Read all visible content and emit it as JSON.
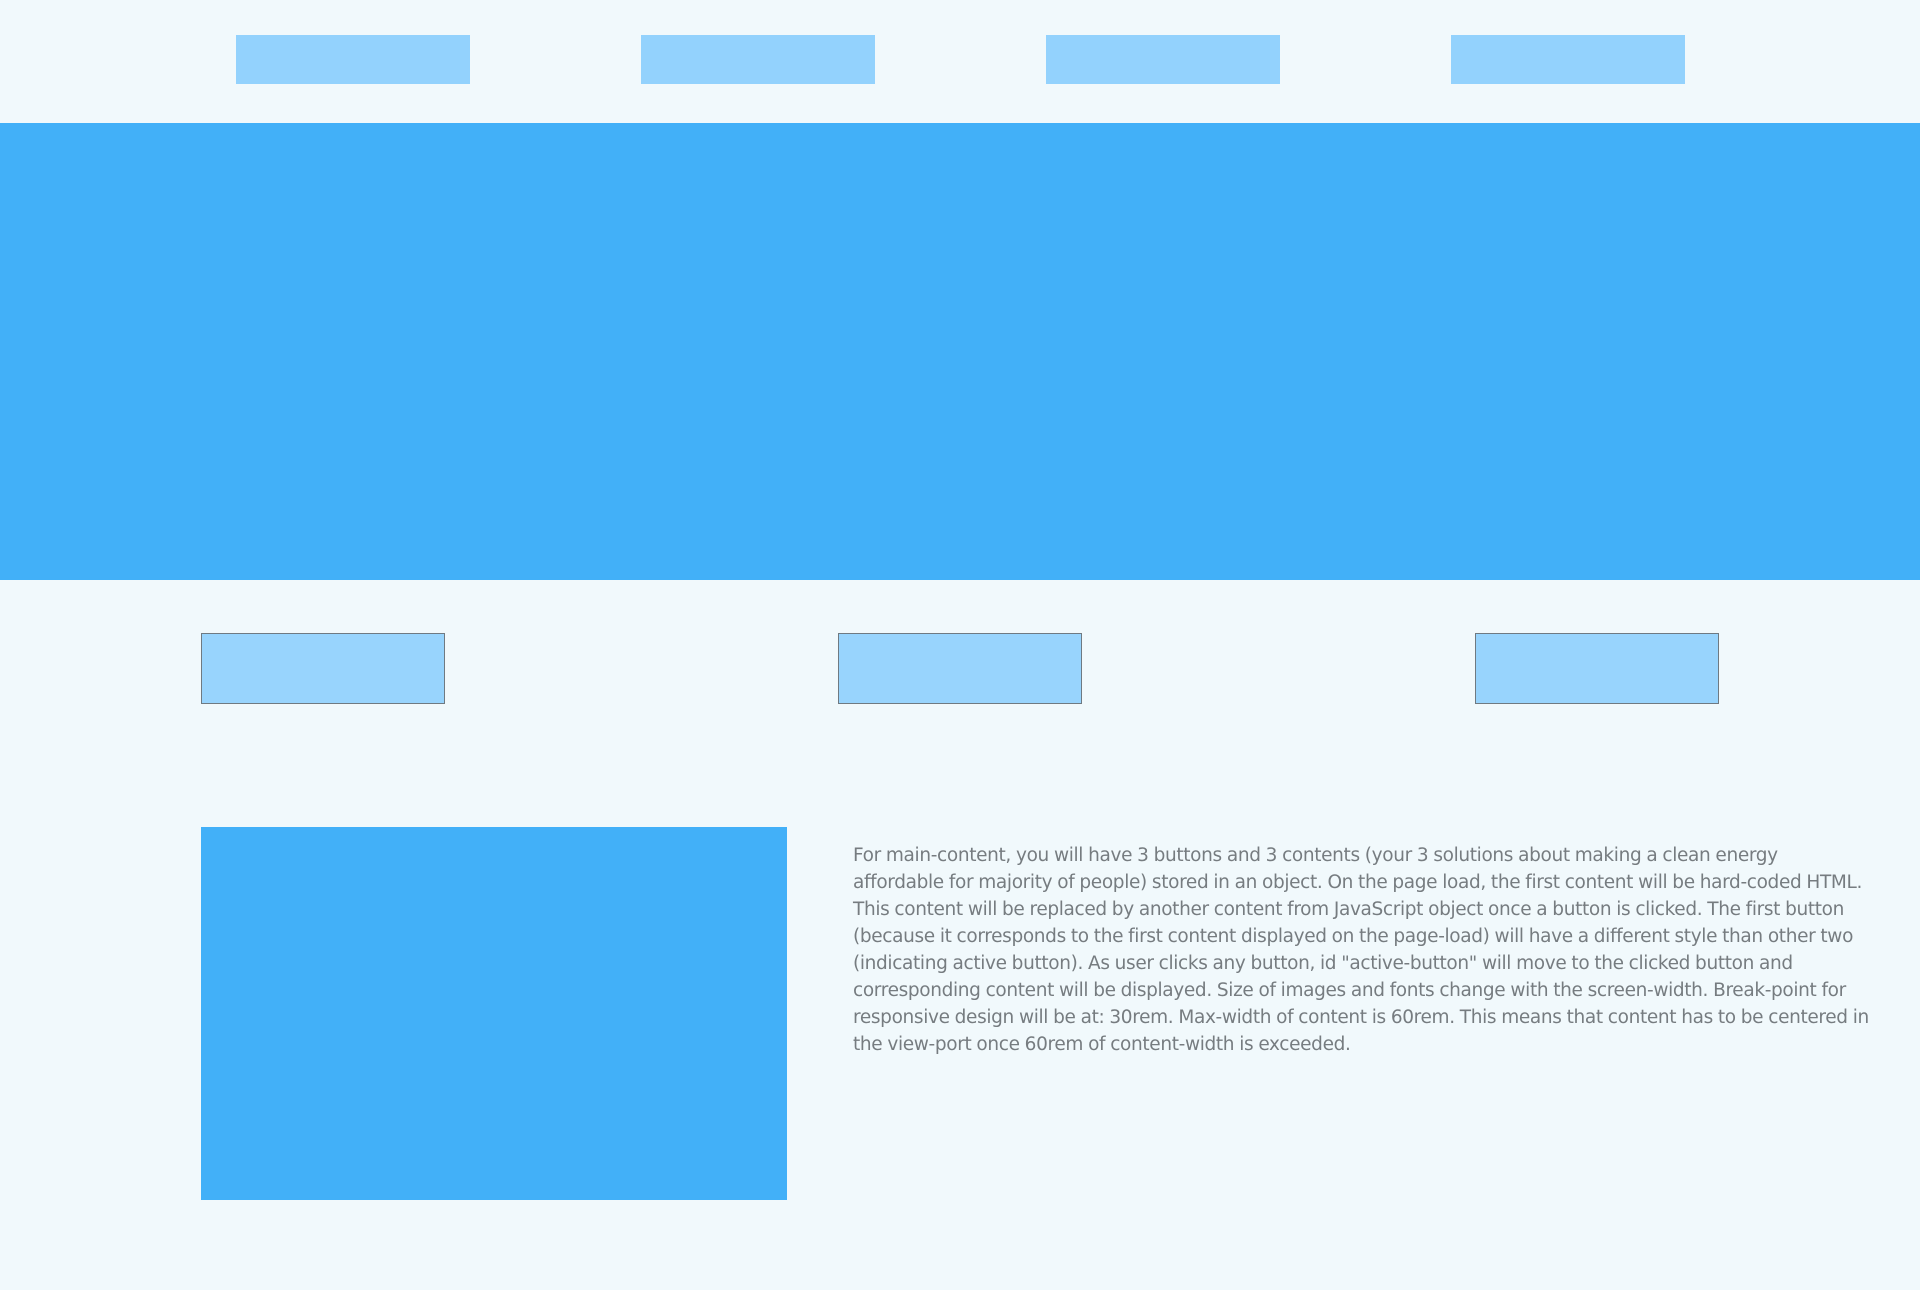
{
  "colors": {
    "page_background": "#f1f9fc",
    "nav_item": "#93d2fd",
    "hero": "#42b0f8",
    "content_button": "#98d4fd",
    "content_button_border": "#6f7a82",
    "content_image": "#42b0f8",
    "text": "#767c80"
  },
  "nav": {
    "items": [
      {
        "label": ""
      },
      {
        "label": ""
      },
      {
        "label": ""
      },
      {
        "label": ""
      }
    ]
  },
  "content_buttons": [
    {
      "label": ""
    },
    {
      "label": ""
    },
    {
      "label": ""
    }
  ],
  "main_content": {
    "text": "For main-content, you will have 3 buttons and 3 contents (your 3 solutions about making a clean energy affordable for majority of people) stored in an object. On the page load, the first content will be hard-coded HTML. This content will be replaced by another content from JavaScript object once a button is clicked. The first button (because it corresponds to the first content displayed on the page-load) will have a different style than other two (indicating active button). As user clicks any button, id \"active-button\" will move to the clicked button and corresponding content will be displayed. Size of images and fonts change with the screen-width. Break-point for responsive design will be at: 30rem. Max-width of content is 60rem. This means that content has to be centered in the view-port once 60rem of content-width is exceeded."
  }
}
